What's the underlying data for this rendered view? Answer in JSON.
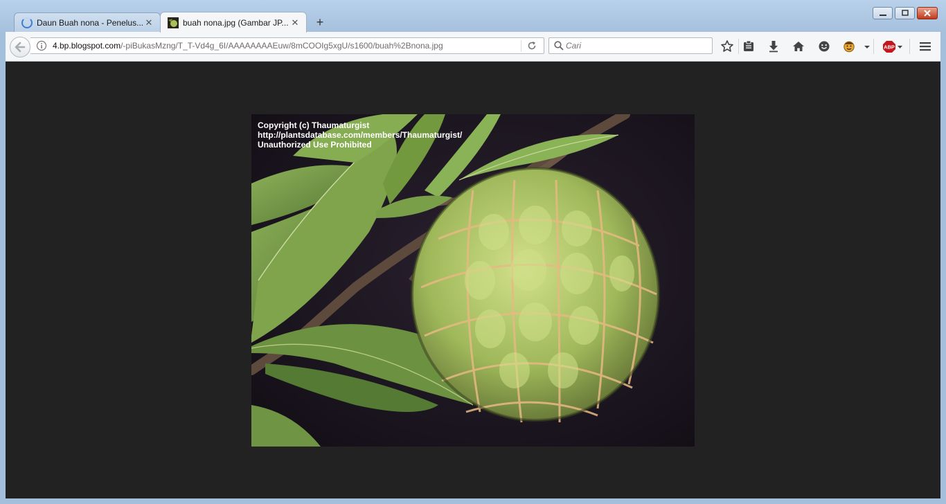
{
  "tabs": [
    {
      "title": "Daun Buah nona - Penelus...",
      "active": false,
      "loading": true
    },
    {
      "title": "buah nona.jpg (Gambar JP...",
      "active": true,
      "loading": false
    }
  ],
  "newtab_label": "+",
  "address": {
    "host": "4.bp.blogspot.com",
    "path": "/-piBukasMzng/T_T-Vd4g_6I/AAAAAAAAEuw/8mCOOIg5xgU/s1600/buah%2Bnona.jpg"
  },
  "search": {
    "placeholder": "Cari"
  },
  "toolbar_icons": [
    "bookmark-star-icon",
    "reading-list-icon",
    "download-icon",
    "home-icon",
    "smiley-icon",
    "extension-face-icon",
    "dropdown-icon",
    "adblock-plus-icon",
    "menu-icon"
  ],
  "adblock_label": "ABP",
  "image": {
    "description_visible": false,
    "overlay_lines": [
      "Copyright (c) Thaumaturgist",
      "http://plantsdatabase.com/members/Thaumaturgist/",
      "Unauthorized Use Prohibited"
    ]
  },
  "colors": {
    "viewer_background": "#222222",
    "chrome_blue": "#a4bfdc"
  }
}
